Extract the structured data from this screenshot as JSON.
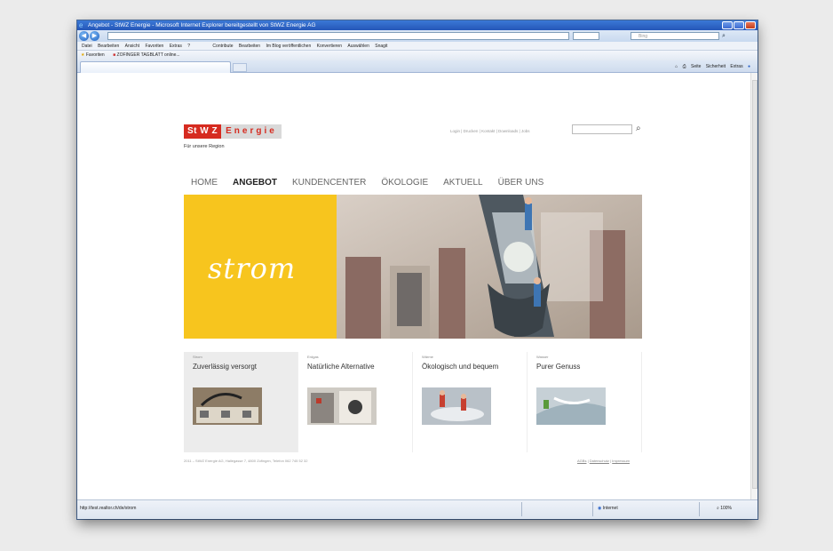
{
  "browser": {
    "title": "Angebot - StWZ Energie - Microsoft Internet Explorer bereitgestellt von StWZ Energie AG",
    "search_placeholder": "Bing",
    "menu": [
      "Datei",
      "Bearbeiten",
      "Ansicht",
      "Favoriten",
      "Extras",
      "?"
    ],
    "toolbar_items": [
      "Contribute",
      "Bearbeiten",
      "Im Blog veröffentlichen",
      "Konvertieren",
      "Auswählen",
      "Snagit"
    ],
    "favorites_label": "Favoriten",
    "favorite_item": "ZOFINGER TAGBLATT online...",
    "command_items": [
      "Seite",
      "Sicherheit",
      "Extras"
    ],
    "status_url": "http://test.realtor.ch/de/strom",
    "status_zone": "Internet",
    "status_zoom": "100%"
  },
  "site": {
    "logo_part1": "St W Z",
    "logo_part2": "Energie",
    "tagline": "Für unsere Region",
    "top_links": "Login | Drucken | Kontakt | Downloads | Jobs",
    "nav": [
      "HOME",
      "ANGEBOT",
      "KUNDENCENTER",
      "ÖKOLOGIE",
      "AKTUELL",
      "ÜBER UNS"
    ],
    "hero_word": "strom",
    "tiles": [
      {
        "category": "Strom",
        "heading": "Zuverlässig versorgt"
      },
      {
        "category": "Erdgas",
        "heading": "Natürliche Alternative"
      },
      {
        "category": "Wärme",
        "heading": "Ökologisch und bequem"
      },
      {
        "category": "Wasser",
        "heading": "Purer Genuss"
      }
    ],
    "footer_text": "2011 – StWZ Energie AG, Hallegasse 7, 4800 Zofingen, Telefon 062 745 52 32",
    "footer_links": [
      "AGBs",
      "Datenschutz",
      "Impressum"
    ]
  },
  "colors": {
    "brand_red": "#d62b20",
    "hero_yellow": "#f7c51e",
    "ie_blue": "#2556b8"
  }
}
